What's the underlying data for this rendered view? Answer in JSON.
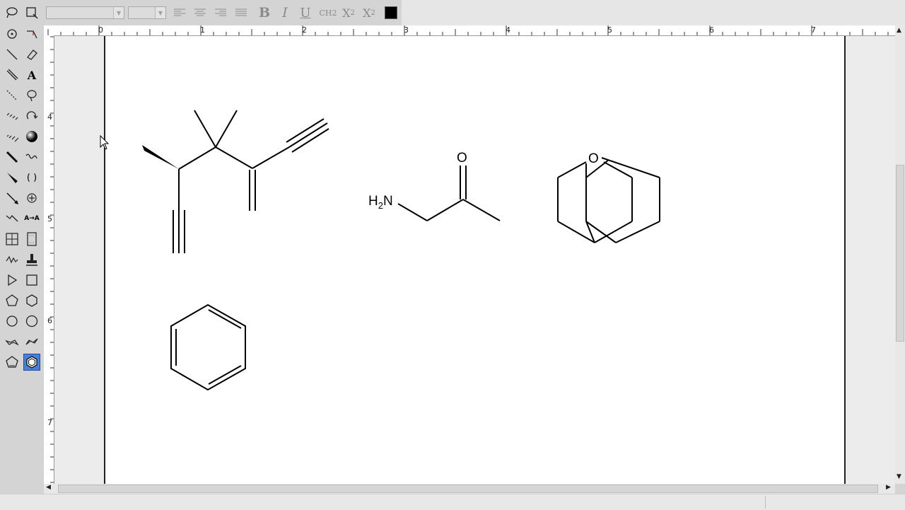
{
  "toolbar": {
    "font_name_value": "",
    "font_size_value": "",
    "bold_label": "B",
    "italic_label": "I",
    "underline_label": "U",
    "formula_label": "CH2",
    "subscript_label": "X2",
    "superscript_label": "X2",
    "color": "#000000"
  },
  "palette": {
    "text_tool_label": "A",
    "map_tool_label": "A→A",
    "bracket_tool_label": "( )"
  },
  "rulers": {
    "top_labels": [
      "0",
      "1",
      "2",
      "3",
      "4",
      "5",
      "6",
      "7"
    ],
    "left_labels": [
      "4",
      "5",
      "6",
      "7"
    ]
  },
  "document": {
    "amine_label": "H2N",
    "amine_h": "H",
    "amine_sub": "2",
    "amine_n": "N",
    "ketone_oxygen_label": "O",
    "oxane_oxygen_label": "O"
  },
  "colors": {
    "active_tool": "#4a7fd6",
    "page_border": "#222222"
  }
}
